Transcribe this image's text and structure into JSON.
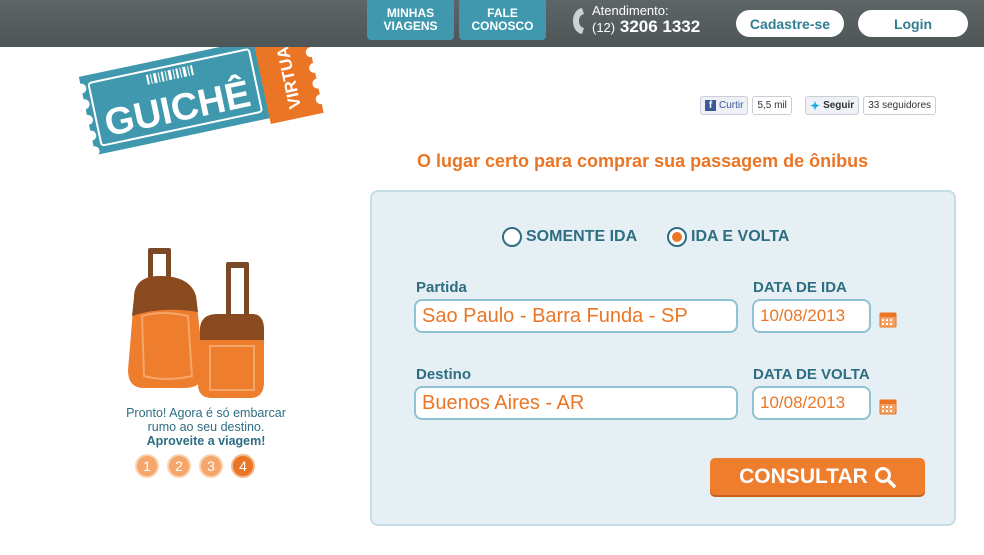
{
  "brand": {
    "logo_main": "GUICHÊ",
    "logo_side": "VIRTUAL"
  },
  "nav": {
    "minhas_viagens": [
      "MINHAS",
      "VIAGENS"
    ],
    "fale_conosco": [
      "FALE",
      "CONOSCO"
    ],
    "atendimento_label": "Atendimento:",
    "phone_area": "(12)",
    "phone_number": "3206 1332",
    "signup_label": "Cadastre-se",
    "login_label": "Login"
  },
  "social": {
    "facebook_label": "Curtir",
    "facebook_count": "5,5 mil",
    "twitter_label": "Seguir",
    "twitter_count": "33 seguidores"
  },
  "tagline": "O lugar certo para comprar sua passagem de ônibus",
  "trip_type": {
    "one_way": "SOMENTE IDA",
    "round_trip": "IDA E VOLTA",
    "selected": "round_trip"
  },
  "form": {
    "origin_label": "Partida",
    "origin_value": "Sao Paulo - Barra Funda - SP",
    "depart_label": "DATA DE IDA",
    "depart_value": "10/08/2013",
    "destination_label": "Destino",
    "destination_value": "Buenos Aires - AR",
    "return_label": "DATA DE VOLTA",
    "return_value": "10/08/2013",
    "submit_label": "CONSULTAR"
  },
  "promo": {
    "line1": "Pronto! Agora é só embarcar",
    "line2": "rumo ao seu destino.",
    "line3": "Aproveite a viagem!",
    "steps": [
      "1",
      "2",
      "3",
      "4"
    ],
    "current_step": 4
  },
  "colors": {
    "accent_orange": "#ea7625",
    "brand_blue": "#3f98ad",
    "topbar": "#555d5f",
    "form_bg": "#e6f0f4"
  }
}
